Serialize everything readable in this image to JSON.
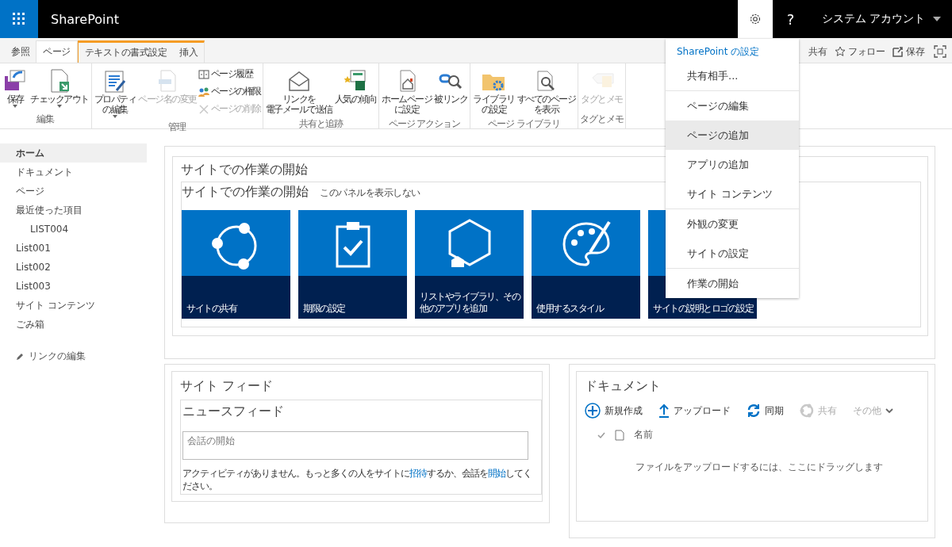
{
  "app_bar": {
    "title": "SharePoint",
    "help": "?",
    "account": "システム アカウント"
  },
  "ribbon": {
    "tabs": [
      {
        "label": "参照",
        "selected": false,
        "kind": "normal"
      },
      {
        "label": "ページ",
        "selected": true,
        "kind": "normal"
      },
      {
        "label": "テキストの書式設定",
        "selected": false,
        "kind": "contextual"
      },
      {
        "label": "挿入",
        "selected": false,
        "kind": "contextual"
      }
    ],
    "actions": [
      {
        "label": "共有"
      },
      {
        "label": "フォロー"
      },
      {
        "label": "保存"
      }
    ],
    "groups": [
      {
        "label": "編集",
        "commands": [
          {
            "lines": [
              "保存"
            ],
            "kind": "large",
            "dropdown": true,
            "disabled": false
          },
          {
            "lines": [
              "チェックアウト"
            ],
            "kind": "large",
            "dropdown": true,
            "disabled": false
          }
        ]
      },
      {
        "label": "管理",
        "commands": [
          {
            "lines": [
              "プロパティ",
              "の編集"
            ],
            "kind": "large",
            "dropdown": true,
            "disabled": false
          },
          {
            "lines": [
              "ページ名の変更"
            ],
            "kind": "large",
            "dropdown": false,
            "disabled": true
          },
          {
            "lines": [
              "ページ履歴"
            ],
            "kind": "small",
            "disabled": false
          },
          {
            "lines": [
              "ページの権限"
            ],
            "kind": "small",
            "disabled": false
          },
          {
            "lines": [
              "ページの削除"
            ],
            "kind": "small",
            "disabled": true
          }
        ]
      },
      {
        "label": "共有と追跡",
        "commands": [
          {
            "lines": [
              "リンクを",
              "電子メールで送信"
            ],
            "kind": "large",
            "dropdown": false,
            "disabled": false
          },
          {
            "lines": [
              "人気の傾向"
            ],
            "kind": "large",
            "dropdown": false,
            "disabled": false
          }
        ]
      },
      {
        "label": "ページ アクション",
        "commands": [
          {
            "lines": [
              "ホームページ",
              "に設定"
            ],
            "kind": "large",
            "dropdown": false,
            "disabled": false
          },
          {
            "lines": [
              "被リンク"
            ],
            "kind": "large",
            "dropdown": false,
            "disabled": false
          }
        ]
      },
      {
        "label": "ページ ライブラリ",
        "commands": [
          {
            "lines": [
              "ライブラリ",
              "の設定"
            ],
            "kind": "large",
            "dropdown": false,
            "disabled": false
          },
          {
            "lines": [
              "すべてのページ",
              "を表示"
            ],
            "kind": "large",
            "dropdown": false,
            "disabled": false
          }
        ]
      },
      {
        "label": "タグとメモ",
        "commands": [
          {
            "lines": [
              "タグとメモ"
            ],
            "kind": "large",
            "dropdown": false,
            "disabled": true
          }
        ]
      }
    ]
  },
  "nav": {
    "items": [
      {
        "label": "ホーム",
        "selected": true
      },
      {
        "label": "ドキュメント",
        "selected": false
      },
      {
        "label": "ページ",
        "selected": false
      },
      {
        "label": "最近使った項目",
        "selected": false,
        "children": [
          {
            "label": "LIST004",
            "selected": false
          }
        ]
      },
      {
        "label": "List001",
        "selected": false
      },
      {
        "label": "List002",
        "selected": false
      },
      {
        "label": "List003",
        "selected": false
      },
      {
        "label": "サイト コンテンツ",
        "selected": false
      },
      {
        "label": "ごみ箱",
        "selected": false
      }
    ],
    "edit_link": "リンクの編集"
  },
  "getting_started": {
    "outer_title": "サイトでの作業の開始",
    "title": "サイトでの作業の開始",
    "hide_link": "このパネルを表示しない",
    "tiles": [
      {
        "label": "サイトの共有"
      },
      {
        "label": "期限の設定"
      },
      {
        "label": "リストやライブラリ、その他のアプリを追加"
      },
      {
        "label": "使用するスタイル"
      },
      {
        "label": "サイトの説明とロゴの設定"
      }
    ]
  },
  "site_feed": {
    "title": "サイト フィード",
    "newsfeed_title": "ニュースフィード",
    "placeholder": "会話の開始",
    "message": [
      {
        "text": "アクティビティがありません。もっと多くの人をサイトに",
        "kind": "text"
      },
      {
        "text": "招待",
        "kind": "link"
      },
      {
        "text": "するか、会話を",
        "kind": "text"
      },
      {
        "text": "開始",
        "kind": "link"
      },
      {
        "text": "してください。",
        "kind": "text"
      }
    ]
  },
  "documents": {
    "title": "ドキュメント",
    "commands": [
      {
        "label": "新規作成",
        "kind": "new",
        "disabled": false
      },
      {
        "label": "アップロード",
        "kind": "upload",
        "disabled": false
      },
      {
        "label": "同期",
        "kind": "sync",
        "disabled": false
      },
      {
        "label": "共有",
        "kind": "share",
        "disabled": true
      },
      {
        "label": "その他",
        "kind": "more",
        "disabled": true
      }
    ],
    "column": "名前",
    "empty": "ファイルをアップロードするには、ここにドラッグします"
  },
  "settings_menu": {
    "header": "SharePoint の設定",
    "sections": [
      [
        {
          "label": "共有相手...",
          "selected": false
        }
      ],
      [
        {
          "label": "ページの編集",
          "selected": false
        },
        {
          "label": "ページの追加",
          "selected": true
        },
        {
          "label": "アプリの追加",
          "selected": false
        },
        {
          "label": "サイト コンテンツ",
          "selected": false
        }
      ],
      [
        {
          "label": "外観の変更",
          "selected": false
        },
        {
          "label": "サイトの設定",
          "selected": false
        }
      ],
      [
        {
          "label": "作業の開始",
          "selected": false
        }
      ]
    ]
  }
}
